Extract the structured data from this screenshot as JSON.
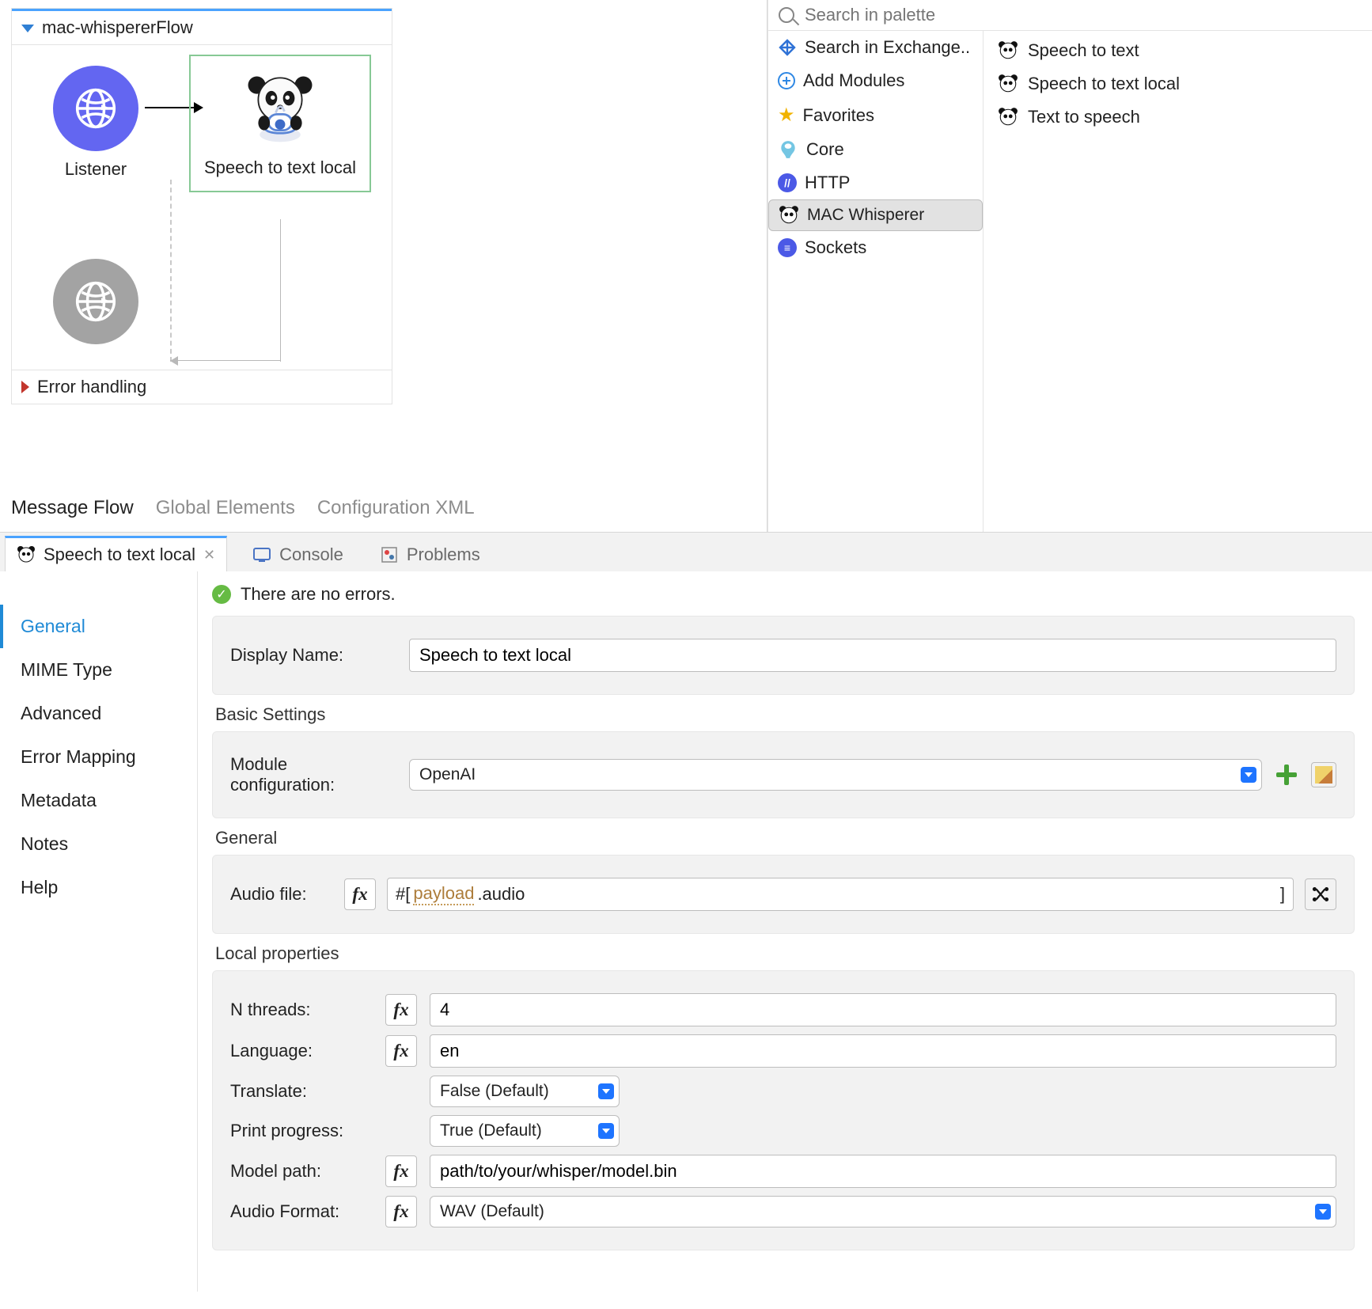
{
  "flow": {
    "title": "mac-whispererFlow",
    "listener": "Listener",
    "sttLocal": "Speech to text local",
    "errorHandling": "Error handling"
  },
  "editorTabs": {
    "messageFlow": "Message Flow",
    "globalElements": "Global Elements",
    "configurationXml": "Configuration XML"
  },
  "palette": {
    "searchPlaceholder": "Search in palette",
    "categories": [
      {
        "label": "Search in Exchange.."
      },
      {
        "label": "Add Modules"
      },
      {
        "label": "Favorites"
      },
      {
        "label": "Core"
      },
      {
        "label": "HTTP"
      },
      {
        "label": "MAC Whisperer"
      },
      {
        "label": "Sockets"
      }
    ],
    "ops": [
      {
        "label": "Speech to text"
      },
      {
        "label": "Speech to text local"
      },
      {
        "label": "Text to speech"
      }
    ]
  },
  "bottomTabs": {
    "sttLocal": "Speech to text local",
    "console": "Console",
    "problems": "Problems"
  },
  "sideNav": [
    "General",
    "MIME Type",
    "Advanced",
    "Error Mapping",
    "Metadata",
    "Notes",
    "Help"
  ],
  "status": "There are no errors.",
  "form": {
    "displayNameLabel": "Display Name:",
    "displayNameValue": "Speech to text local",
    "basicSettingsTitle": "Basic Settings",
    "moduleConfigLabel": "Module configuration:",
    "moduleConfigValue": "OpenAI",
    "generalTitle": "General",
    "audioFileLabel": "Audio file:",
    "audioExprPrefix": "#[ ",
    "audioExprToken": "payload",
    "audioExprSuffix": ".audio",
    "audioExprEnd": "]",
    "localPropsTitle": "Local properties",
    "nThreadsLabel": "N threads:",
    "nThreadsValue": "4",
    "languageLabel": "Language:",
    "languageValue": "en",
    "translateLabel": "Translate:",
    "translateValue": "False (Default)",
    "printProgressLabel": "Print progress:",
    "printProgressValue": "True (Default)",
    "modelPathLabel": "Model path:",
    "modelPathValue": "path/to/your/whisper/model.bin",
    "audioFormatLabel": "Audio Format:",
    "audioFormatValue": "WAV (Default)"
  }
}
